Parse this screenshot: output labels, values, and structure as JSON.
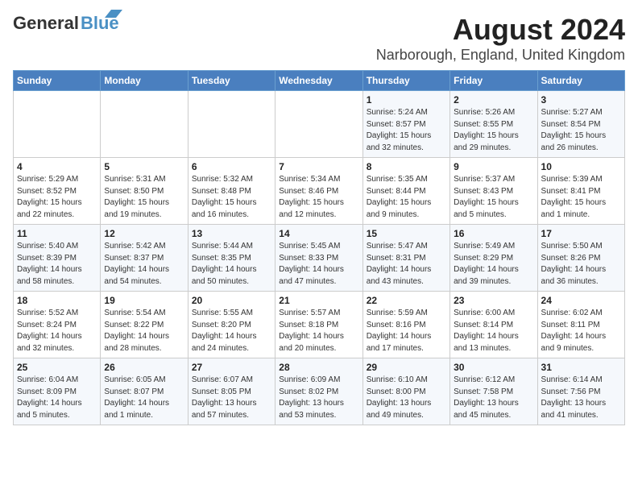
{
  "app": {
    "logo_general": "General",
    "logo_blue": "Blue",
    "title": "August 2024",
    "subtitle": "Narborough, England, United Kingdom"
  },
  "calendar": {
    "headers": [
      "Sunday",
      "Monday",
      "Tuesday",
      "Wednesday",
      "Thursday",
      "Friday",
      "Saturday"
    ],
    "weeks": [
      [
        {
          "day": "",
          "info": ""
        },
        {
          "day": "",
          "info": ""
        },
        {
          "day": "",
          "info": ""
        },
        {
          "day": "",
          "info": ""
        },
        {
          "day": "1",
          "info": "Sunrise: 5:24 AM\nSunset: 8:57 PM\nDaylight: 15 hours\nand 32 minutes."
        },
        {
          "day": "2",
          "info": "Sunrise: 5:26 AM\nSunset: 8:55 PM\nDaylight: 15 hours\nand 29 minutes."
        },
        {
          "day": "3",
          "info": "Sunrise: 5:27 AM\nSunset: 8:54 PM\nDaylight: 15 hours\nand 26 minutes."
        }
      ],
      [
        {
          "day": "4",
          "info": "Sunrise: 5:29 AM\nSunset: 8:52 PM\nDaylight: 15 hours\nand 22 minutes."
        },
        {
          "day": "5",
          "info": "Sunrise: 5:31 AM\nSunset: 8:50 PM\nDaylight: 15 hours\nand 19 minutes."
        },
        {
          "day": "6",
          "info": "Sunrise: 5:32 AM\nSunset: 8:48 PM\nDaylight: 15 hours\nand 16 minutes."
        },
        {
          "day": "7",
          "info": "Sunrise: 5:34 AM\nSunset: 8:46 PM\nDaylight: 15 hours\nand 12 minutes."
        },
        {
          "day": "8",
          "info": "Sunrise: 5:35 AM\nSunset: 8:44 PM\nDaylight: 15 hours\nand 9 minutes."
        },
        {
          "day": "9",
          "info": "Sunrise: 5:37 AM\nSunset: 8:43 PM\nDaylight: 15 hours\nand 5 minutes."
        },
        {
          "day": "10",
          "info": "Sunrise: 5:39 AM\nSunset: 8:41 PM\nDaylight: 15 hours\nand 1 minute."
        }
      ],
      [
        {
          "day": "11",
          "info": "Sunrise: 5:40 AM\nSunset: 8:39 PM\nDaylight: 14 hours\nand 58 minutes."
        },
        {
          "day": "12",
          "info": "Sunrise: 5:42 AM\nSunset: 8:37 PM\nDaylight: 14 hours\nand 54 minutes."
        },
        {
          "day": "13",
          "info": "Sunrise: 5:44 AM\nSunset: 8:35 PM\nDaylight: 14 hours\nand 50 minutes."
        },
        {
          "day": "14",
          "info": "Sunrise: 5:45 AM\nSunset: 8:33 PM\nDaylight: 14 hours\nand 47 minutes."
        },
        {
          "day": "15",
          "info": "Sunrise: 5:47 AM\nSunset: 8:31 PM\nDaylight: 14 hours\nand 43 minutes."
        },
        {
          "day": "16",
          "info": "Sunrise: 5:49 AM\nSunset: 8:29 PM\nDaylight: 14 hours\nand 39 minutes."
        },
        {
          "day": "17",
          "info": "Sunrise: 5:50 AM\nSunset: 8:26 PM\nDaylight: 14 hours\nand 36 minutes."
        }
      ],
      [
        {
          "day": "18",
          "info": "Sunrise: 5:52 AM\nSunset: 8:24 PM\nDaylight: 14 hours\nand 32 minutes."
        },
        {
          "day": "19",
          "info": "Sunrise: 5:54 AM\nSunset: 8:22 PM\nDaylight: 14 hours\nand 28 minutes."
        },
        {
          "day": "20",
          "info": "Sunrise: 5:55 AM\nSunset: 8:20 PM\nDaylight: 14 hours\nand 24 minutes."
        },
        {
          "day": "21",
          "info": "Sunrise: 5:57 AM\nSunset: 8:18 PM\nDaylight: 14 hours\nand 20 minutes."
        },
        {
          "day": "22",
          "info": "Sunrise: 5:59 AM\nSunset: 8:16 PM\nDaylight: 14 hours\nand 17 minutes."
        },
        {
          "day": "23",
          "info": "Sunrise: 6:00 AM\nSunset: 8:14 PM\nDaylight: 14 hours\nand 13 minutes."
        },
        {
          "day": "24",
          "info": "Sunrise: 6:02 AM\nSunset: 8:11 PM\nDaylight: 14 hours\nand 9 minutes."
        }
      ],
      [
        {
          "day": "25",
          "info": "Sunrise: 6:04 AM\nSunset: 8:09 PM\nDaylight: 14 hours\nand 5 minutes."
        },
        {
          "day": "26",
          "info": "Sunrise: 6:05 AM\nSunset: 8:07 PM\nDaylight: 14 hours\nand 1 minute."
        },
        {
          "day": "27",
          "info": "Sunrise: 6:07 AM\nSunset: 8:05 PM\nDaylight: 13 hours\nand 57 minutes."
        },
        {
          "day": "28",
          "info": "Sunrise: 6:09 AM\nSunset: 8:02 PM\nDaylight: 13 hours\nand 53 minutes."
        },
        {
          "day": "29",
          "info": "Sunrise: 6:10 AM\nSunset: 8:00 PM\nDaylight: 13 hours\nand 49 minutes."
        },
        {
          "day": "30",
          "info": "Sunrise: 6:12 AM\nSunset: 7:58 PM\nDaylight: 13 hours\nand 45 minutes."
        },
        {
          "day": "31",
          "info": "Sunrise: 6:14 AM\nSunset: 7:56 PM\nDaylight: 13 hours\nand 41 minutes."
        }
      ]
    ]
  }
}
